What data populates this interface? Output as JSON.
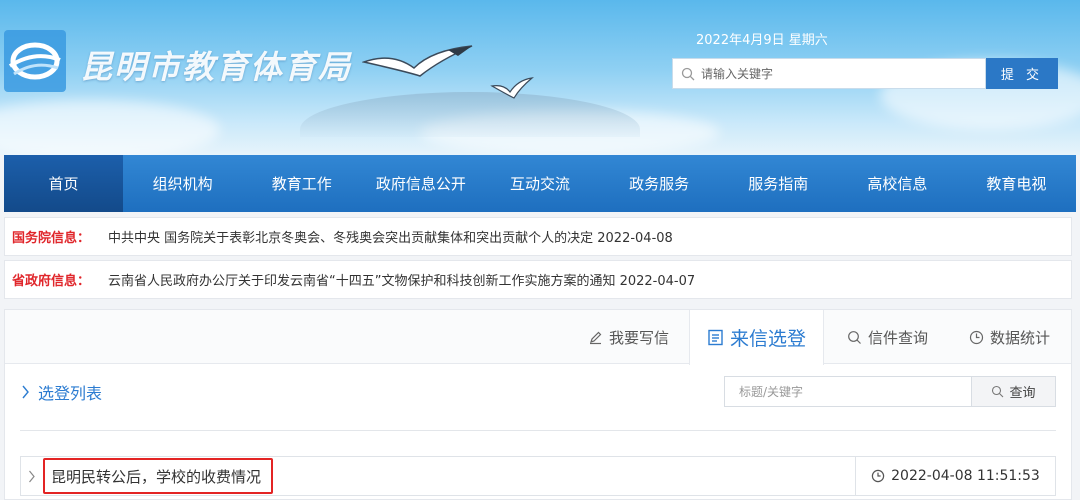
{
  "header": {
    "site_title": "昆明市教育体育局",
    "date": "2022年4月9日 星期六",
    "search_placeholder": "请输入关键字",
    "submit_label": "提 交"
  },
  "nav": {
    "items": [
      {
        "label": "首页",
        "active": true
      },
      {
        "label": "组织机构"
      },
      {
        "label": "教育工作"
      },
      {
        "label": "政府信息公开"
      },
      {
        "label": "互动交流"
      },
      {
        "label": "政务服务"
      },
      {
        "label": "服务指南"
      },
      {
        "label": "高校信息"
      },
      {
        "label": "教育电视"
      }
    ]
  },
  "notices": [
    {
      "label": "国务院信息：",
      "text": "中共中央 国务院关于表彰北京冬奥会、冬残奥会突出贡献集体和突出贡献个人的决定 2022-04-08"
    },
    {
      "label": "省政府信息：",
      "text": "云南省人民政府办公厅关于印发云南省“十四五”文物保护和科技创新工作实施方案的通知 2022-04-07"
    }
  ],
  "tabs": [
    {
      "label": "我要写信",
      "icon": "pen-icon"
    },
    {
      "label": "来信选登",
      "icon": "list-icon",
      "active": true
    },
    {
      "label": "信件查询",
      "icon": "search-icon"
    },
    {
      "label": "数据统计",
      "icon": "clock-icon"
    }
  ],
  "list": {
    "section_title": "选登列表",
    "filter_placeholder": "标题/关键字",
    "query_label": "查询",
    "rows": [
      {
        "title": "昆明民转公后，学校的收费情况",
        "time": "2022-04-08 11:51:53"
      }
    ]
  },
  "colors": {
    "nav_blue": "#1e6fbf",
    "accent_blue": "#2c7cd1",
    "notice_red": "#e0262b",
    "highlight_red": "#e32424"
  }
}
